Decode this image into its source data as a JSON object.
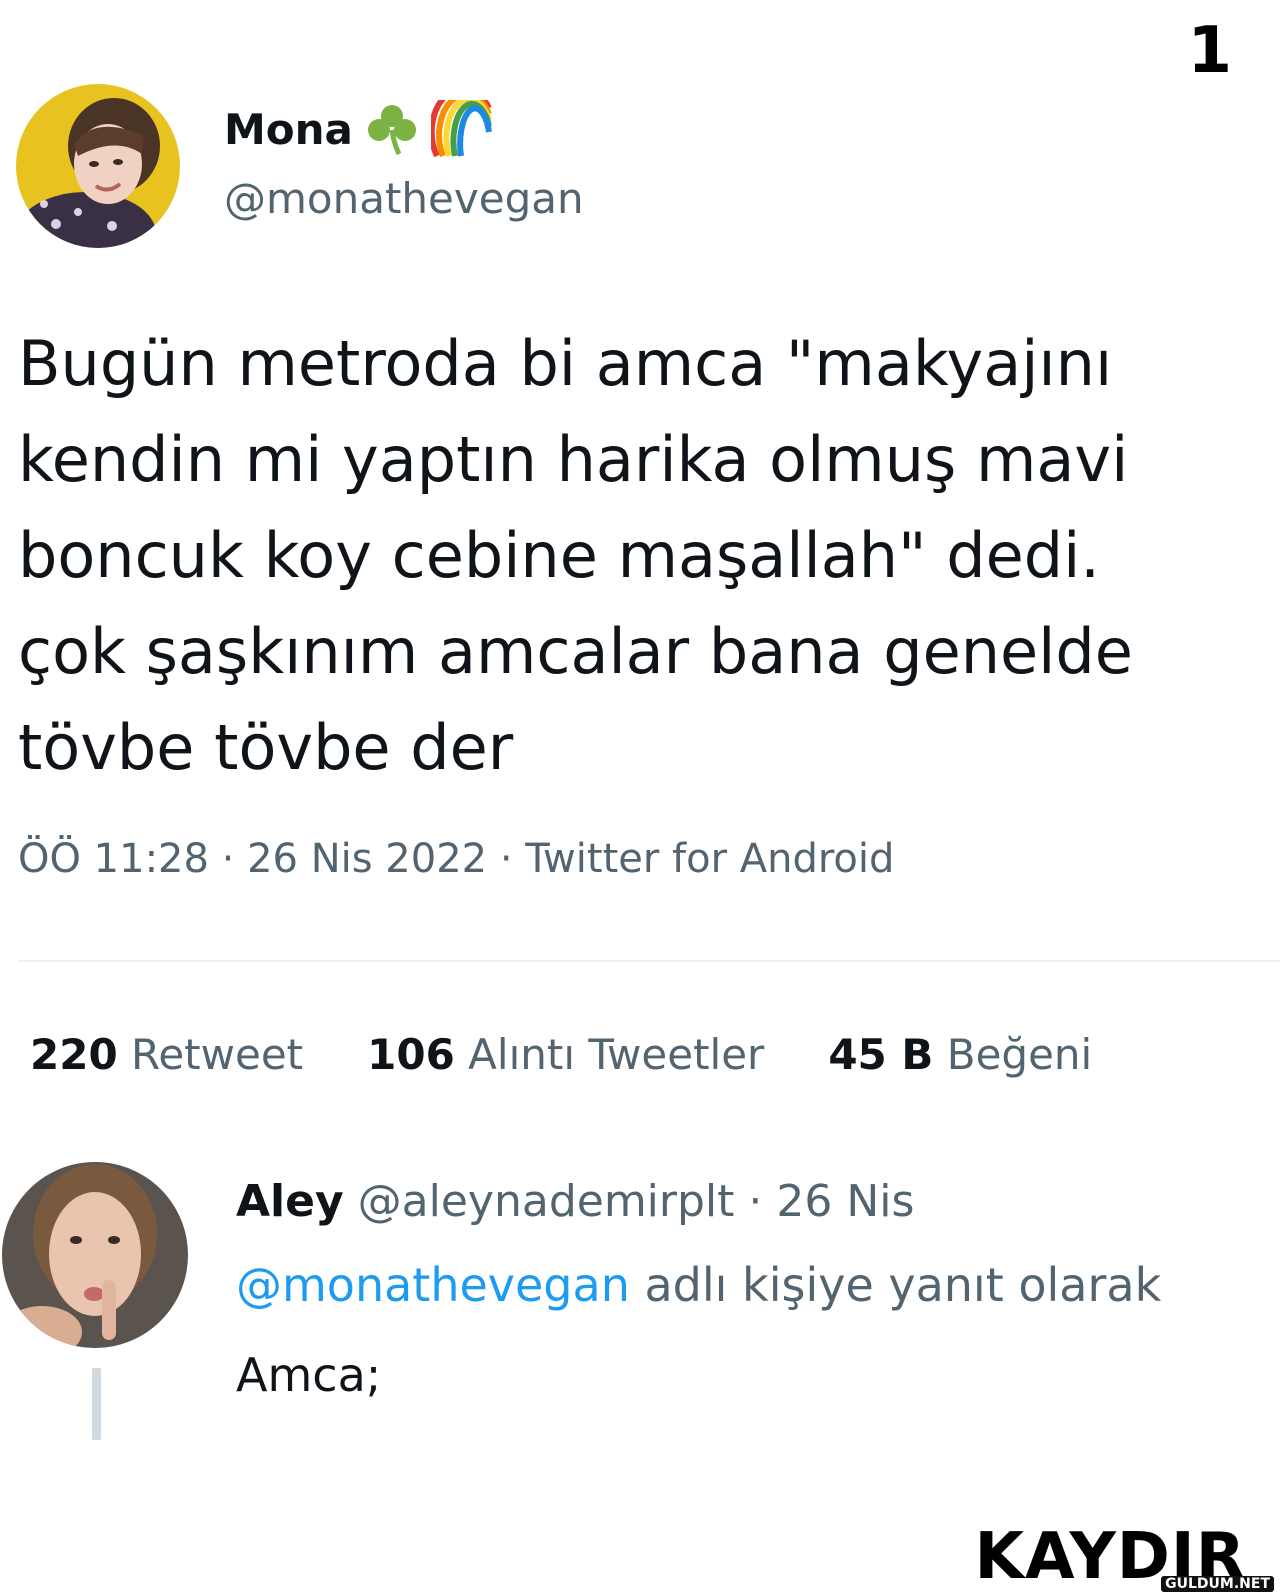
{
  "page_number": "1",
  "tweet": {
    "author_name": "Mona",
    "author_handle": "@monathevegan",
    "name_emojis": [
      "shamrock-icon",
      "rainbow-icon"
    ],
    "text_lines": [
      "Bugün metroda bi amca \"makyajını",
      "kendin mi yaptın harika olmuş mavi",
      "boncuk koy cebine maşallah\" dedi.",
      "çok şaşkınım amcalar bana genelde",
      "tövbe tövbe der"
    ],
    "meta": "ÖÖ 11:28 · 26 Nis 2022 · Twitter for Android"
  },
  "stats": [
    {
      "count": "220",
      "label": "Retweet"
    },
    {
      "count": "106",
      "label": "Alıntı Tweetler"
    },
    {
      "count": "45 B",
      "label": "Beğeni"
    }
  ],
  "reply": {
    "author_name": "Aley",
    "author_handle": "@aleynademirplt",
    "separator": "·",
    "date": "26 Nis",
    "reply_to_mention": "@monathevegan",
    "reply_to_text": "adlı kişiye yanıt olarak",
    "text": "Amca;"
  },
  "footer": {
    "swipe_label": "KAYDIR",
    "watermark": "GULDUM.NET"
  },
  "colors": {
    "text_primary": "#0f1419",
    "text_secondary": "#536471",
    "mention_blue": "#1d9bf0",
    "divider": "#eff3f4"
  }
}
